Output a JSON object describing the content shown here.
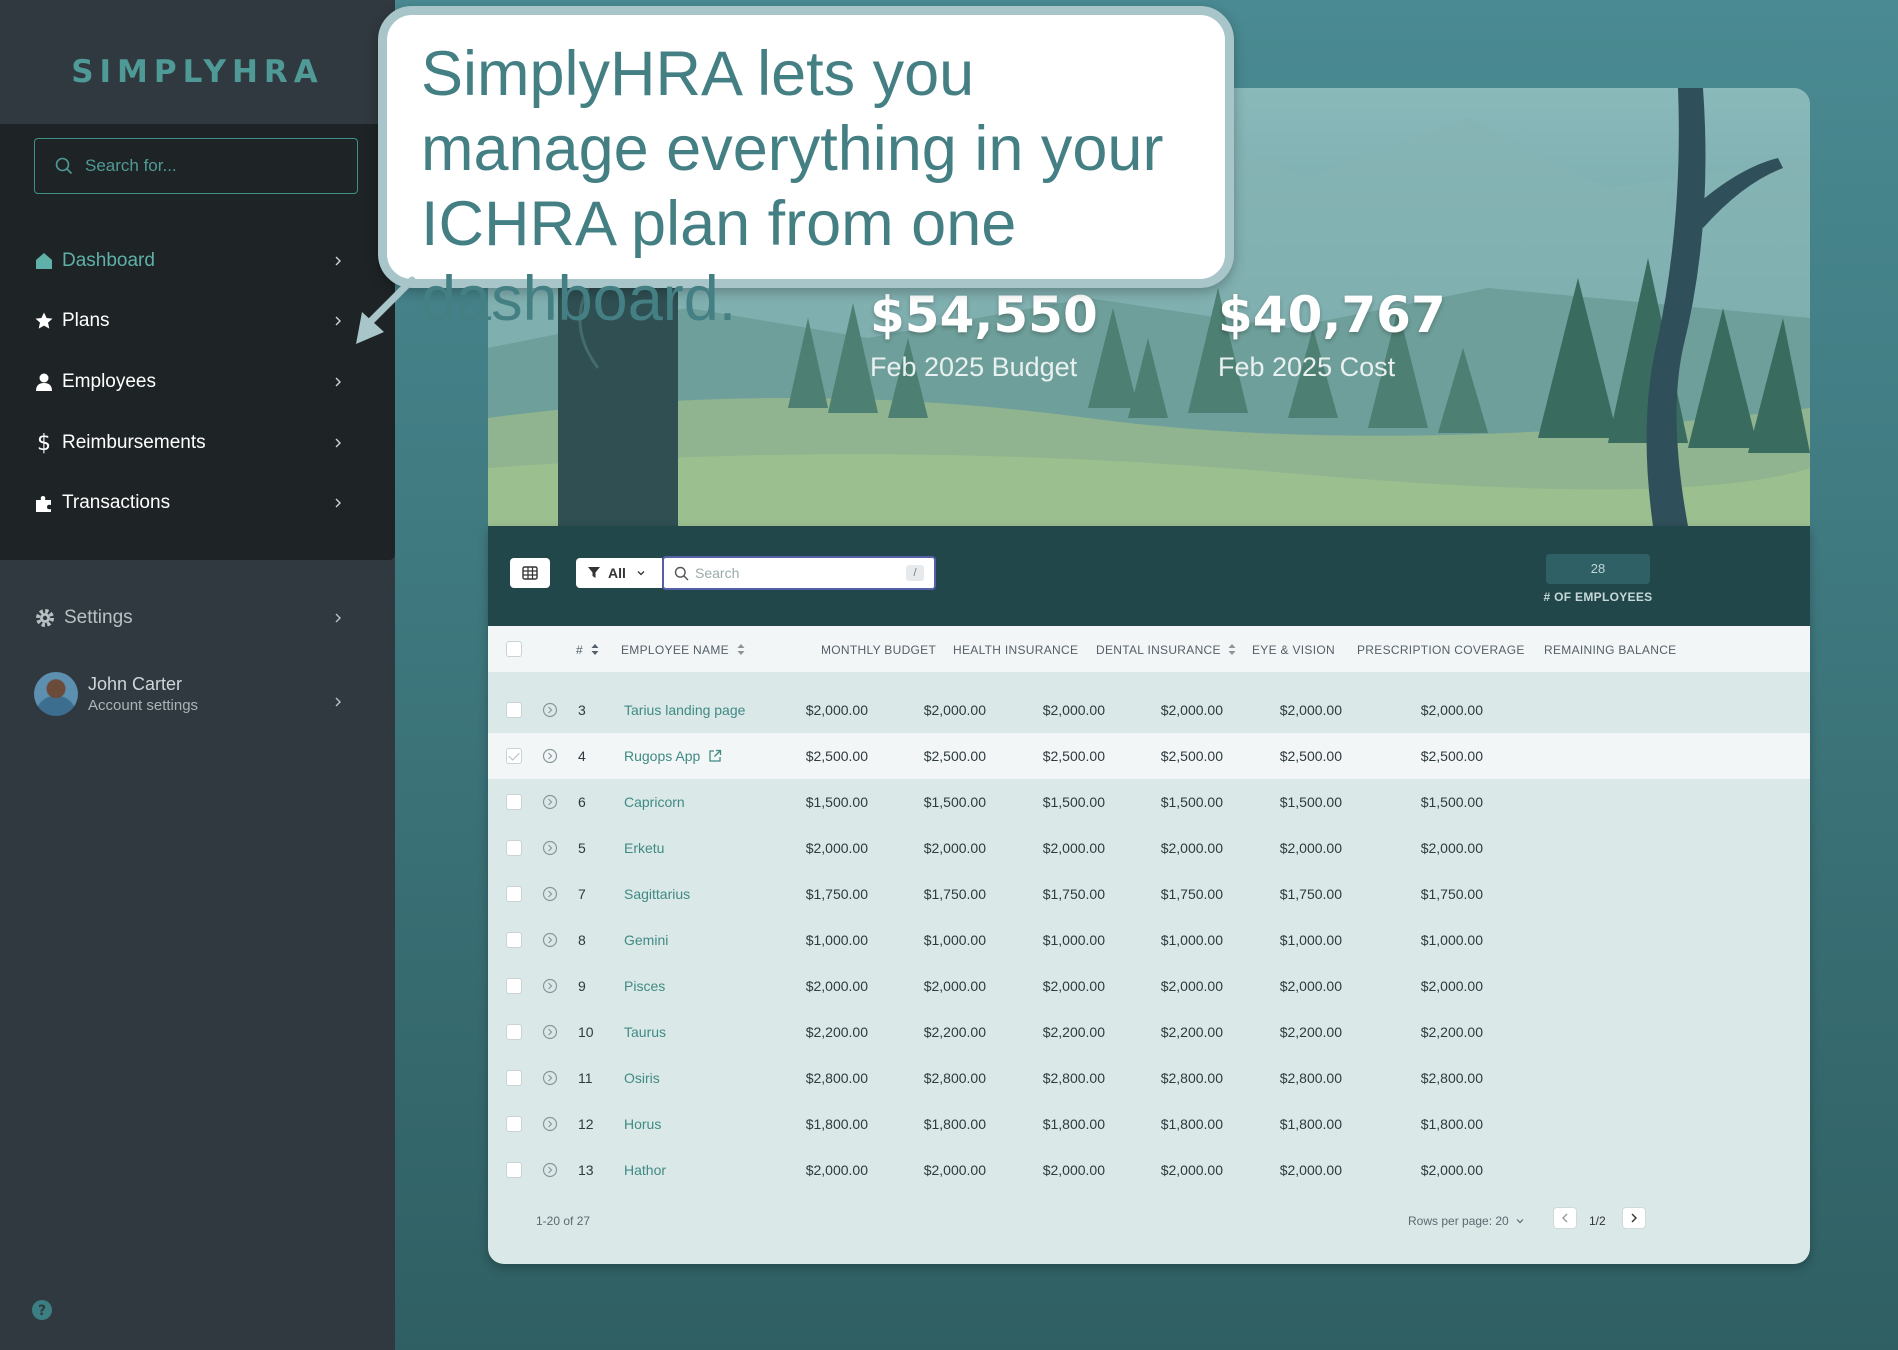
{
  "sidebar": {
    "logo": "SIMPLYHRA",
    "search_placeholder": "Search for...",
    "items": [
      {
        "label": "Dashboard",
        "icon": "home-icon",
        "active": true
      },
      {
        "label": "Plans",
        "icon": "star-icon"
      },
      {
        "label": "Employees",
        "icon": "user-icon"
      },
      {
        "label": "Reimbursements",
        "icon": "dollar-icon"
      },
      {
        "label": "Transactions",
        "icon": "puzzle-icon"
      }
    ],
    "settings_label": "Settings",
    "user": {
      "name": "John Carter",
      "subtitle": "Account settings"
    }
  },
  "callout": {
    "text": "SimplyHRA lets you manage everything in your ICHRA plan from one dashboard."
  },
  "hero": {
    "budget": {
      "value": "$54,550",
      "label": "Feb 2025 Budget"
    },
    "cost": {
      "value": "$40,767",
      "label": "Feb 2025 Cost"
    }
  },
  "table": {
    "filter_label": "All",
    "search_placeholder": "Search",
    "search_shortcut": "/",
    "employee_count": "28",
    "employee_count_label": "# OF EMPLOYEES",
    "columns": [
      "#",
      "EMPLOYEE NAME",
      "MONTHLY BUDGET",
      "HEALTH INSURANCE",
      "DENTAL INSURANCE",
      "EYE & VISION",
      "PRESCRIPTION COVERAGE",
      "REMAINING BALANCE"
    ],
    "rows": [
      {
        "num": "3",
        "name": "Tarius landing page",
        "values": [
          "$2,000.00",
          "$2,000.00",
          "$2,000.00",
          "$2,000.00",
          "$2,000.00",
          "$2,000.00"
        ]
      },
      {
        "num": "4",
        "name": "Rugops App",
        "external": true,
        "checked": true,
        "highlight": true,
        "values": [
          "$2,500.00",
          "$2,500.00",
          "$2,500.00",
          "$2,500.00",
          "$2,500.00",
          "$2,500.00"
        ]
      },
      {
        "num": "6",
        "name": "Capricorn",
        "values": [
          "$1,500.00",
          "$1,500.00",
          "$1,500.00",
          "$1,500.00",
          "$1,500.00",
          "$1,500.00"
        ]
      },
      {
        "num": "5",
        "name": "Erketu",
        "values": [
          "$2,000.00",
          "$2,000.00",
          "$2,000.00",
          "$2,000.00",
          "$2,000.00",
          "$2,000.00"
        ]
      },
      {
        "num": "7",
        "name": "Sagittarius",
        "values": [
          "$1,750.00",
          "$1,750.00",
          "$1,750.00",
          "$1,750.00",
          "$1,750.00",
          "$1,750.00"
        ]
      },
      {
        "num": "8",
        "name": "Gemini",
        "values": [
          "$1,000.00",
          "$1,000.00",
          "$1,000.00",
          "$1,000.00",
          "$1,000.00",
          "$1,000.00"
        ]
      },
      {
        "num": "9",
        "name": "Pisces",
        "values": [
          "$2,000.00",
          "$2,000.00",
          "$2,000.00",
          "$2,000.00",
          "$2,000.00",
          "$2,000.00"
        ]
      },
      {
        "num": "10",
        "name": "Taurus",
        "values": [
          "$2,200.00",
          "$2,200.00",
          "$2,200.00",
          "$2,200.00",
          "$2,200.00",
          "$2,200.00"
        ]
      },
      {
        "num": "11",
        "name": "Osiris",
        "values": [
          "$2,800.00",
          "$2,800.00",
          "$2,800.00",
          "$2,800.00",
          "$2,800.00",
          "$2,800.00"
        ]
      },
      {
        "num": "12",
        "name": "Horus",
        "values": [
          "$1,800.00",
          "$1,800.00",
          "$1,800.00",
          "$1,800.00",
          "$1,800.00",
          "$1,800.00"
        ]
      },
      {
        "num": "13",
        "name": "Hathor",
        "values": [
          "$2,000.00",
          "$2,000.00",
          "$2,000.00",
          "$2,000.00",
          "$2,000.00",
          "$2,000.00"
        ]
      }
    ],
    "footer": {
      "range": "1-20 of 27",
      "rows_per_page": "Rows per page: 20",
      "page": "1/2"
    }
  },
  "colors": {
    "accent": "#4f9a96",
    "sidebar_bg": "#30393f",
    "nav_panel_bg": "#1e2325",
    "toolbar_bg": "#22474b",
    "link": "#3f8a84"
  }
}
